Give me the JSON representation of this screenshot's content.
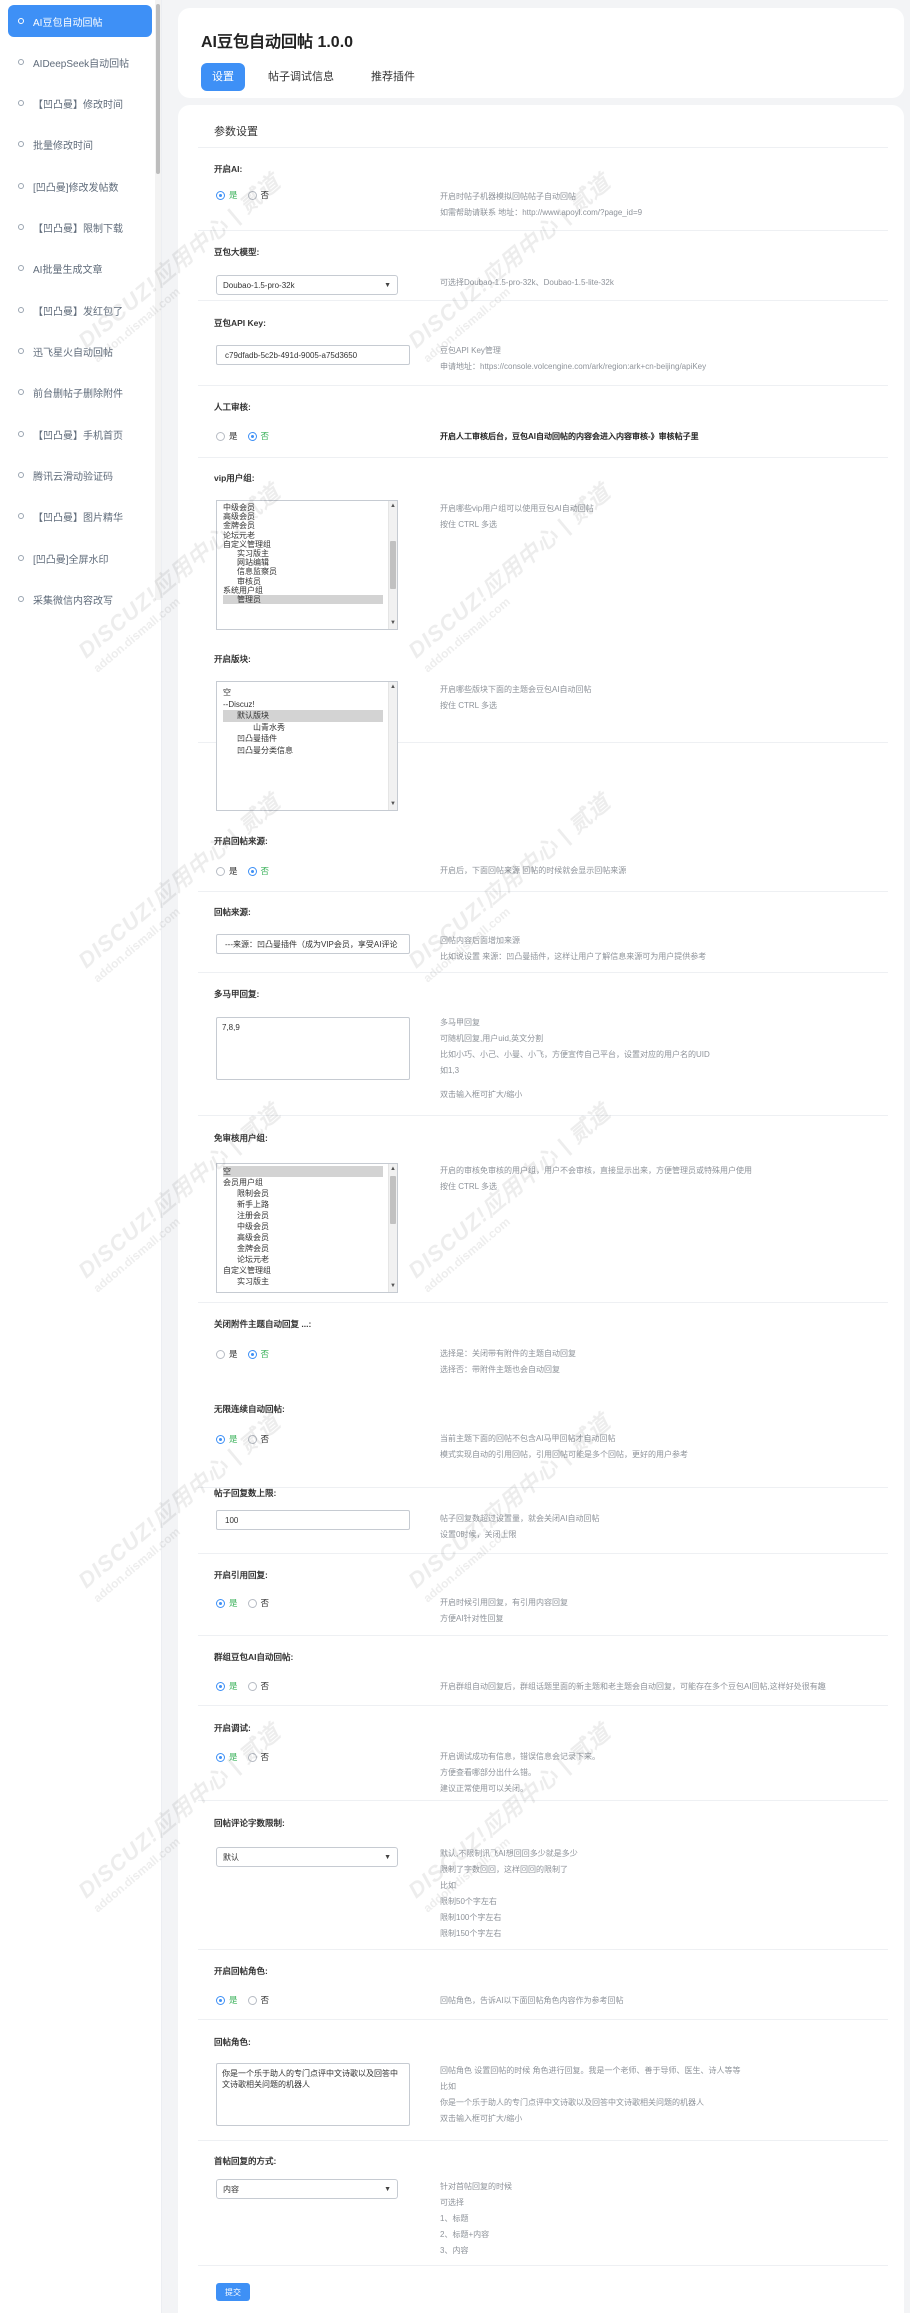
{
  "sidebar": {
    "items": [
      {
        "label": "AI豆包自动回帖",
        "active": true
      },
      {
        "label": "AIDeepSeek自动回帖",
        "active": false
      },
      {
        "label": "【凹凸曼】修改时间",
        "active": false
      },
      {
        "label": "批量修改时间",
        "active": false
      },
      {
        "label": "[凹凸曼]修改发帖数",
        "active": false
      },
      {
        "label": "【凹凸曼】限制下载",
        "active": false
      },
      {
        "label": "AI批量生成文章",
        "active": false
      },
      {
        "label": "【凹凸曼】发红包了",
        "active": false
      },
      {
        "label": "迅飞星火自动回帖",
        "active": false
      },
      {
        "label": "前台删帖子删除附件",
        "active": false
      },
      {
        "label": "【凹凸曼】手机首页",
        "active": false
      },
      {
        "label": "腾讯云滑动验证码",
        "active": false
      },
      {
        "label": "【凹凸曼】图片精华",
        "active": false
      },
      {
        "label": "[凹凸曼]全屏水印",
        "active": false
      },
      {
        "label": "采集微信内容改写",
        "active": false
      }
    ]
  },
  "header": {
    "title": "AI豆包自动回帖 1.0.0",
    "tabs": [
      {
        "label": "设置",
        "active": true
      },
      {
        "label": "帖子调试信息",
        "active": false
      },
      {
        "label": "推荐插件",
        "active": false
      }
    ]
  },
  "panel": {
    "title": "参数设置"
  },
  "settings": {
    "enable_ai": {
      "label": "开启AI:",
      "yes": "是",
      "no": "否",
      "desc": [
        "开启时帖子机器模拟回帖帖子自动回帖",
        "如需帮助请联系 地址：http://www.apoyl.com/?page_id=9"
      ]
    },
    "model": {
      "label": "豆包大模型:",
      "value": "Doubao-1.5-pro-32k",
      "desc": [
        "可选择Doubao-1.5-pro-32k、Doubao-1.5-lite-32k"
      ]
    },
    "api_key": {
      "label": "豆包API Key:",
      "value": "c79dfadb-5c2b-491d-9005-a75d3650",
      "desc": [
        "豆包API Key管理",
        "申请地址：https://console.volcengine.com/ark/region:ark+cn-beijing/apiKey"
      ]
    },
    "manual_review": {
      "label": "人工审核:",
      "yes": "是",
      "no": "否",
      "desc": [
        "开启人工审核后台，豆包AI自动回帖的内容会进入内容审核-》审核帖子里"
      ]
    },
    "vip_groups": {
      "label": "vip用户组:",
      "options": [
        "中级会员",
        "高级会员",
        "金牌会员",
        "论坛元老",
        "自定义管理组",
        "实习版主",
        "网站编辑",
        "信息监察员",
        "审核员",
        "系统用户组",
        "管理员"
      ],
      "desc": [
        "开启哪些vip用户组可以使用豆包AI自动回帖",
        "按住 CTRL 多选"
      ]
    },
    "forums": {
      "label": "开启版块:",
      "options": [
        "空",
        "--Discuz!",
        "默认版块",
        "山青水秀",
        "凹凸曼插件",
        "凹凸曼分类信息"
      ],
      "desc": [
        "开启哪些版块下面的主题会豆包AI自动回帖",
        "按住 CTRL 多选"
      ]
    },
    "reply_source_toggle": {
      "label": "开启回帖来源:",
      "yes": "是",
      "no": "否",
      "desc": [
        "开启后，下面回帖来源 回帖的时候就会显示回帖来源"
      ]
    },
    "reply_source": {
      "label": "回帖来源:",
      "value": "---来源：凹凸曼插件（成为VIP会员，享受AI评论",
      "desc": [
        "回帖内容后面增加来源",
        "比如说设置 来源：凹凸曼插件，这样让用户了解信息来源可为用户提供参考"
      ]
    },
    "vest": {
      "label": "多马甲回复:",
      "value": "7,8,9",
      "desc": [
        "多马甲回复",
        "可随机回复,用户uid,英文分割",
        "比如小巧、小己、小曼、小飞，方便宣传自己平台，设置对应的用户名的UID",
        "如1,3",
        "",
        "双击输入框可扩大/缩小"
      ]
    },
    "exempt_groups": {
      "label": "免审核用户组:",
      "options": [
        "空",
        "会员用户组",
        "限制会员",
        "新手上路",
        "注册会员",
        "中级会员",
        "高级会员",
        "金牌会员",
        "论坛元老",
        "自定义管理组",
        "实习版主"
      ],
      "desc": [
        "开启的审核免审核的用户组，用户不会审核，直接显示出来，方便管理员或特殊用户使用",
        "按住 CTRL 多选"
      ]
    },
    "attach_topics": {
      "label": "关闭附件主题自动回复 ...:",
      "yes": "是",
      "no": "否",
      "desc": [
        "选择是：关闭带有附件的主题自动回复",
        "选择否：带附件主题也会自动回复"
      ]
    },
    "no_quote": {
      "label": "无限连续自动回帖:",
      "yes": "是",
      "no": "否",
      "desc": [
        "当前主题下面的回帖不包含AI马甲回帖才自动回帖",
        "模式实现自动的引用回帖，引用回帖可能是多个回帖，更好的用户参考"
      ]
    },
    "max_replies": {
      "label": "帖子回复数上限:",
      "value": "100",
      "desc": [
        "帖子回复数超过设置量，就会关闭AI自动回帖",
        "设置0时候，关闭上限"
      ]
    },
    "quote_reply": {
      "label": "开启引用回复:",
      "yes": "是",
      "no": "否",
      "desc": [
        "开启时候引用回复，有引用内容回复",
        "方便AI针对性回复"
      ]
    },
    "group_reply": {
      "label": "群组豆包AI自动回帖:",
      "yes": "是",
      "no": "否",
      "desc": [
        "开启群组自动回复后，群组话题里面的新主题和老主题会自动回复，可能存在多个豆包AI回帖,这样好处很有趣"
      ]
    },
    "debug": {
      "label": "开启调试:",
      "yes": "是",
      "no": "否",
      "desc": [
        "开启调试成功有信息，错误信息会记录下来。",
        "方便查看哪部分出什么错。",
        "建议正常使用可以关闭。"
      ]
    },
    "word_limit": {
      "label": "回帖评论字数限制:",
      "value": "默认",
      "desc": [
        "默认,不限制讯飞AI想回回多少就是多少",
        "限制了字数回回，这样回回的限制了",
        "比如",
        "限制50个字左右",
        "限制100个字左右",
        "限制150个字左右"
      ]
    },
    "role_toggle": {
      "label": "开启回帖角色:",
      "yes": "是",
      "no": "否",
      "desc": [
        "回帖角色，告诉AI以下面回帖角色内容作为参考回帖"
      ]
    },
    "role": {
      "label": "回帖角色:",
      "value": "你是一个乐于助人的专门点评中文诗歌以及回答中文诗歌相关问题的机器人",
      "desc": [
        "回帖角色 设置回帖的时候 角色进行回复。我是一个老师、善于导师、医生、诗人等等",
        "比如",
        "你是一个乐于助人的专门点评中文诗歌以及回答中文诗歌相关问题的机器人",
        "双击输入框可扩大/缩小"
      ]
    },
    "reply_mode": {
      "label": "首帖回复的方式:",
      "value": "内容",
      "desc": [
        "针对首帖回复的时候",
        "可选择",
        "1、标题",
        "2、标题+内容",
        "3、内容"
      ]
    },
    "submit": "提交"
  },
  "watermark": {
    "line1": "DISCUZ!应用中心 | 贰道",
    "line2": "addon.dismall.com"
  }
}
